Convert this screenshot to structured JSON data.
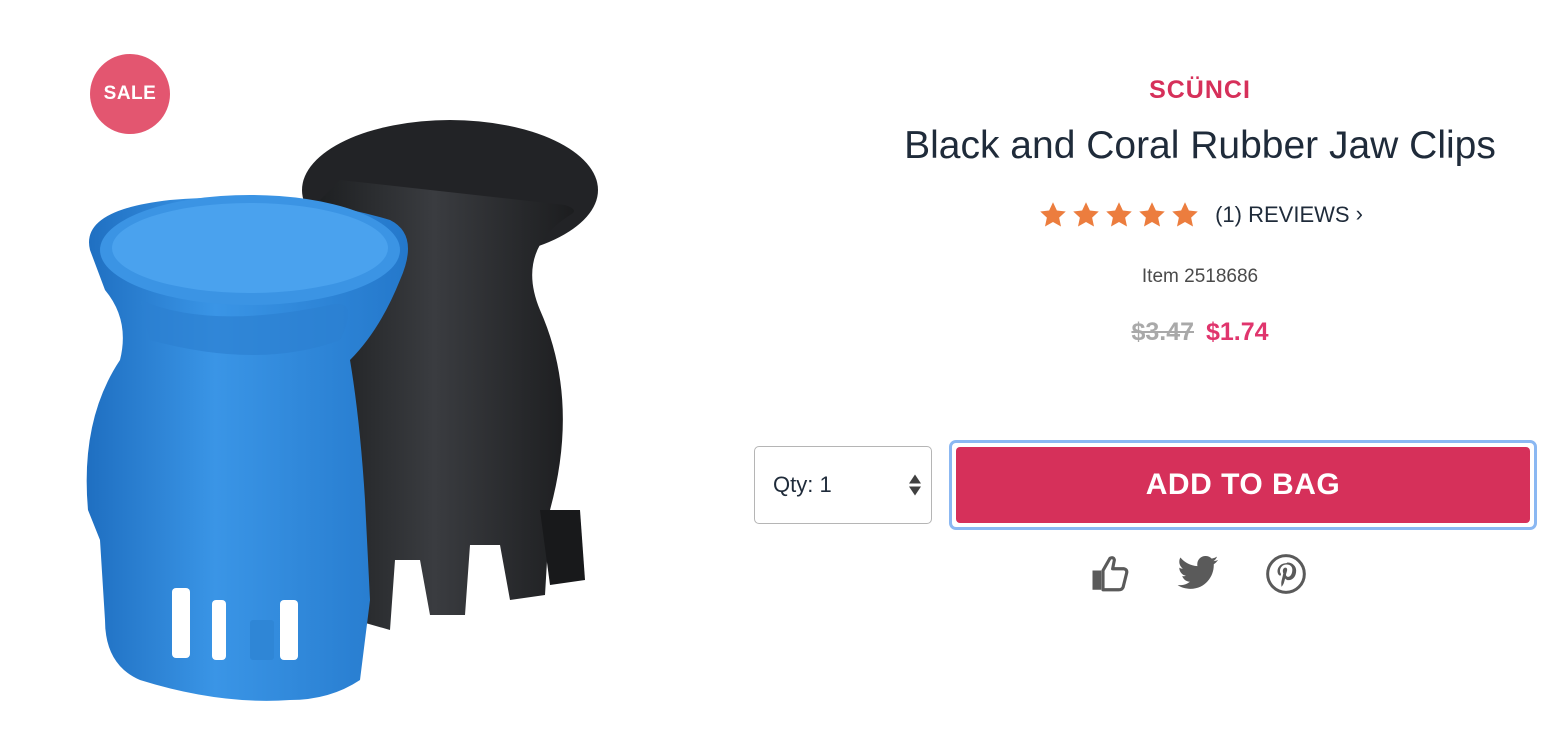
{
  "badge": {
    "label": "SALE"
  },
  "product": {
    "brand": "SCÜNCI",
    "title": "Black and Coral Rubber Jaw Clips",
    "rating": {
      "stars": 5,
      "max": 5,
      "reviews_label": "(1) REVIEWS"
    },
    "item_number": "Item 2518686",
    "price": {
      "original": "$3.47",
      "sale": "$1.74"
    }
  },
  "purchase": {
    "quantity_label": "Qty: 1",
    "add_to_bag_label": "ADD TO BAG"
  },
  "share": {
    "icons": [
      "thumbs-up-icon",
      "twitter-icon",
      "pinterest-icon"
    ]
  },
  "colors": {
    "brand_accent": "#d6305a",
    "sale_price": "#e0356d",
    "sale_badge": "#e35670",
    "star": "#ec7d3e",
    "clip_blue": "#2f86d6",
    "clip_black": "#2b2d30"
  }
}
